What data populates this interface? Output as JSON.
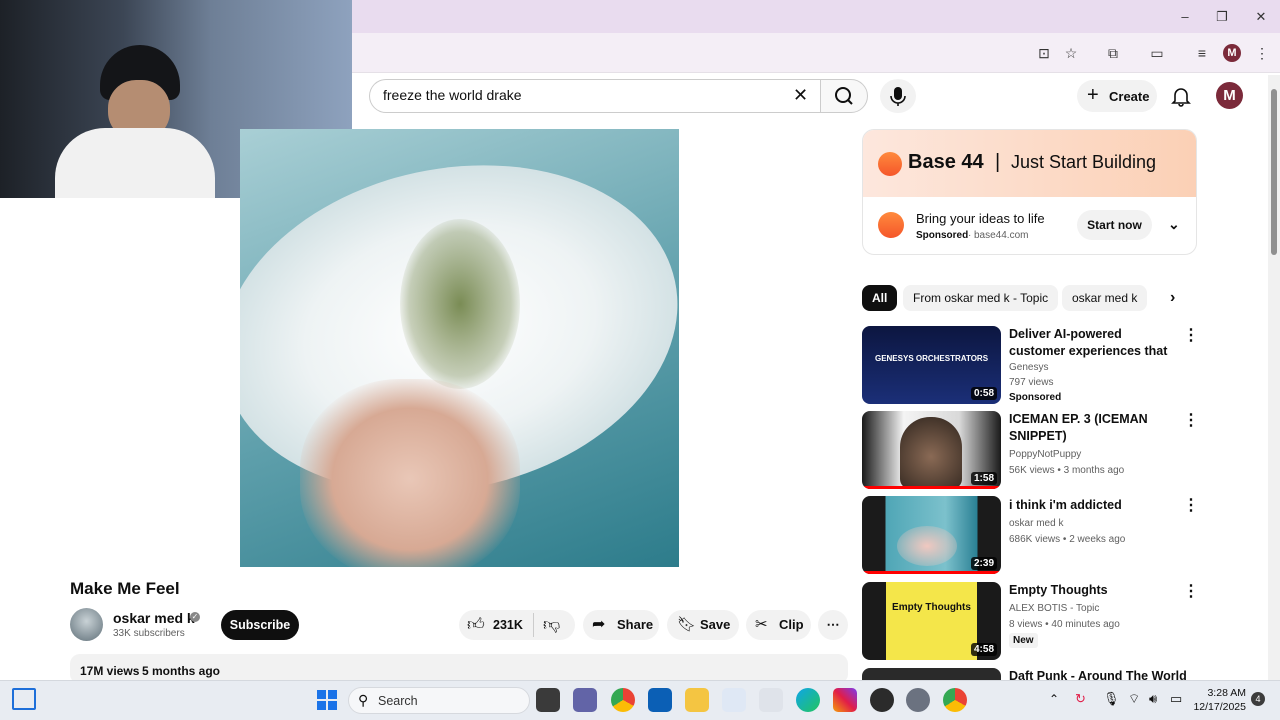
{
  "window": {
    "minimize": "–",
    "restore": "❐",
    "close": "✕"
  },
  "browser_profile": "M",
  "search": {
    "query": "freeze the world drake"
  },
  "header": {
    "create_label": "Create",
    "profile_initial": "M"
  },
  "video": {
    "title": "Make Me Feel",
    "channel": "oskar med k",
    "subscribers": "33K subscribers",
    "subscribe_label": "Subscribe",
    "likes": "231K",
    "share_label": "Share",
    "save_label": "Save",
    "clip_label": "Clip",
    "views": "17M views",
    "age": "5 months ago"
  },
  "ad": {
    "brand": "Base 44",
    "tagline": "Just Start Building",
    "headline": "Bring your ideas to life",
    "sponsored": "Sponsored",
    "domain": "base44.com",
    "cta": "Start now"
  },
  "chips": [
    "All",
    "From oskar med k - Topic",
    "oskar med k"
  ],
  "recommendations": [
    {
      "title": "Deliver AI-powered customer experiences that feel effortles...",
      "channel": "Genesys",
      "meta": "797 views",
      "extra": "Sponsored",
      "duration": "0:58",
      "thumb_text": "GENESYS ORCHESTRATORS"
    },
    {
      "title": "ICEMAN EP. 3 (ICEMAN SNIPPET)",
      "channel": "PoppyNotPuppy",
      "meta": "56K views • 3 months ago",
      "extra": "",
      "duration": "1:58"
    },
    {
      "title": "i think i'm addicted",
      "channel": "oskar med k",
      "meta": "686K views • 2 weeks ago",
      "extra": "",
      "duration": "2:39"
    },
    {
      "title": "Empty Thoughts",
      "channel": "ALEX BOTIS - Topic",
      "meta": "8 views • 40 minutes ago",
      "extra": "New",
      "duration": "4:58",
      "thumb_text": "Empty Thoughts"
    },
    {
      "title": "Daft Punk - Around The World",
      "channel": "",
      "meta": "",
      "extra": "",
      "duration": ""
    }
  ],
  "taskbar": {
    "search_placeholder": "Search",
    "time": "3:28 AM",
    "date": "12/17/2025",
    "notifications": "4"
  },
  "colors": {
    "accent_red": "#ff0000",
    "subscribe_bg": "#0f0f0f",
    "taskbar_bg": "#e8ecf2"
  }
}
